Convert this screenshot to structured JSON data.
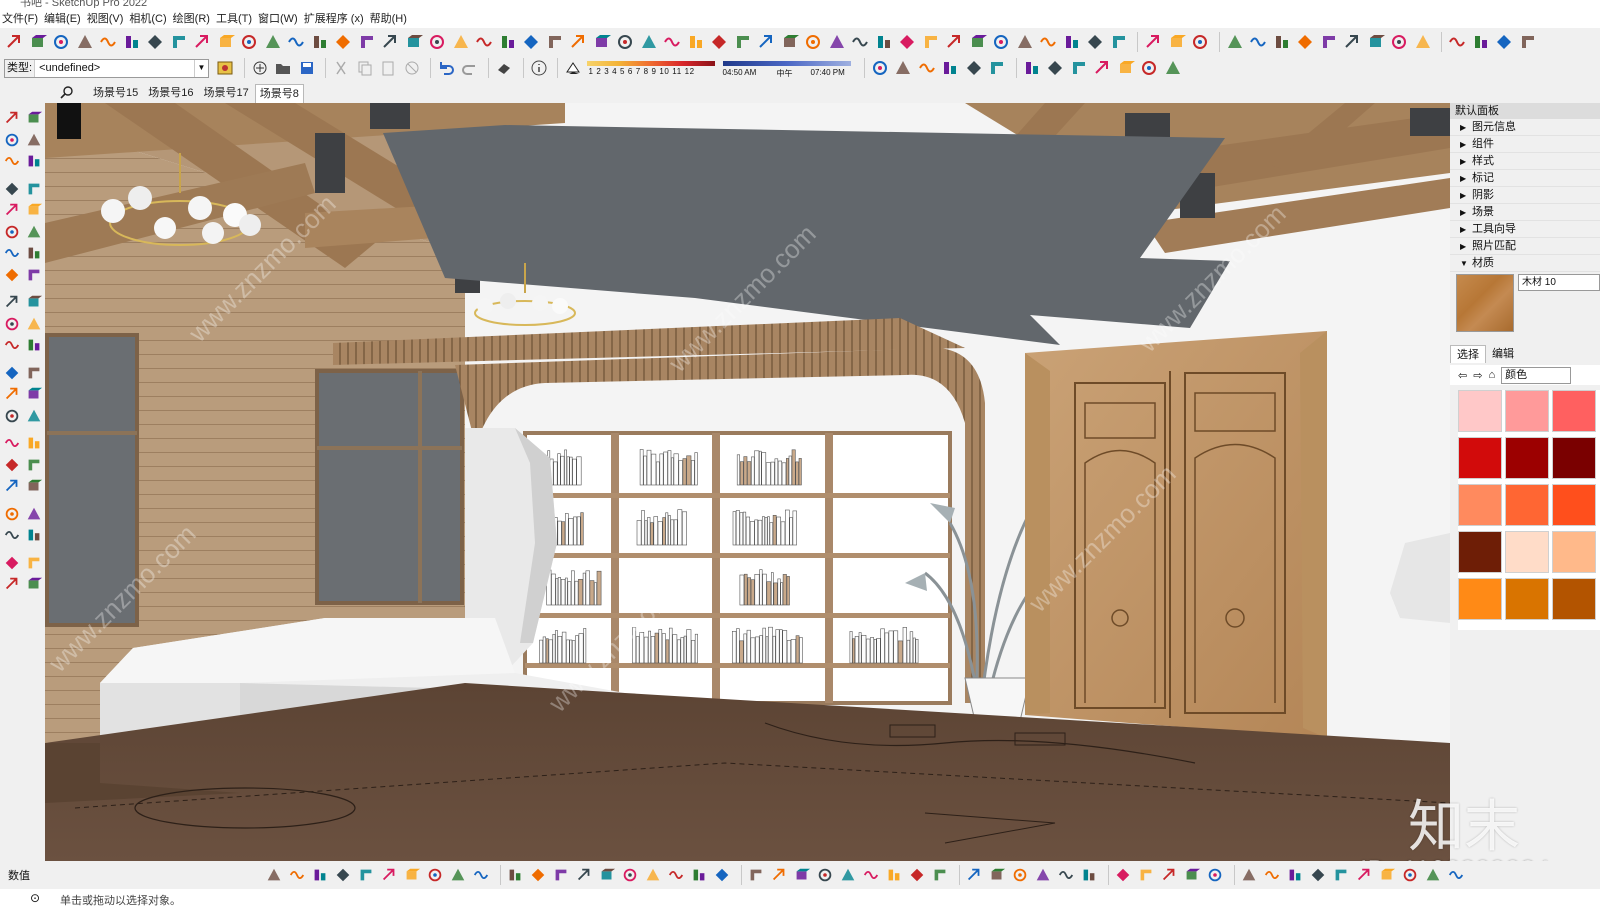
{
  "app": {
    "title": "书吧 - SketchUp Pro 2022"
  },
  "menu": [
    "文件(F)",
    "编辑(E)",
    "视图(V)",
    "相机(C)",
    "绘图(R)",
    "工具(T)",
    "窗口(W)",
    "扩展程序 (x)",
    "帮助(H)"
  ],
  "layer": {
    "label": "类型:",
    "value": "<undefined>"
  },
  "shadow_scale": {
    "months": "1 2 3 4 5 6 7 8 9 10 11 12"
  },
  "time_scale": {
    "start": "04:50 AM",
    "mid": "中午",
    "end": "07:40 PM"
  },
  "scenes": {
    "tabs": [
      {
        "label": "场景号15",
        "active": false
      },
      {
        "label": "场景号16",
        "active": false
      },
      {
        "label": "场景号17",
        "active": false
      },
      {
        "label": "场景号8",
        "active": true
      }
    ]
  },
  "tray": {
    "title": "默认面板",
    "sections": [
      {
        "label": "图元信息",
        "expanded": false
      },
      {
        "label": "组件",
        "expanded": false
      },
      {
        "label": "样式",
        "expanded": false
      },
      {
        "label": "标记",
        "expanded": false
      },
      {
        "label": "阴影",
        "expanded": false
      },
      {
        "label": "场景",
        "expanded": false
      },
      {
        "label": "工具向导",
        "expanded": false
      },
      {
        "label": "照片匹配",
        "expanded": false
      },
      {
        "label": "材质",
        "expanded": true
      }
    ],
    "materials": {
      "name": "木材 10",
      "tabs": [
        "选择",
        "编辑"
      ],
      "collection": "颜色",
      "swatches": [
        "#ffc8c8",
        "#ff9a9a",
        "#ff6060",
        "#d20b0b",
        "#9c0000",
        "#7a0000",
        "#ff8a5e",
        "#ff6633",
        "#ff4f1c",
        "#6e1e06",
        "#ffdcc8",
        "#ffb98a",
        "#ff8a16",
        "#d97400",
        "#b35400"
      ]
    }
  },
  "status": {
    "measure_label": "数值",
    "hint": "单击或拖动以选择对象。"
  },
  "watermark": {
    "logo": "知末",
    "site": "www.znzmo.com",
    "id": "ID: 1163309024"
  }
}
